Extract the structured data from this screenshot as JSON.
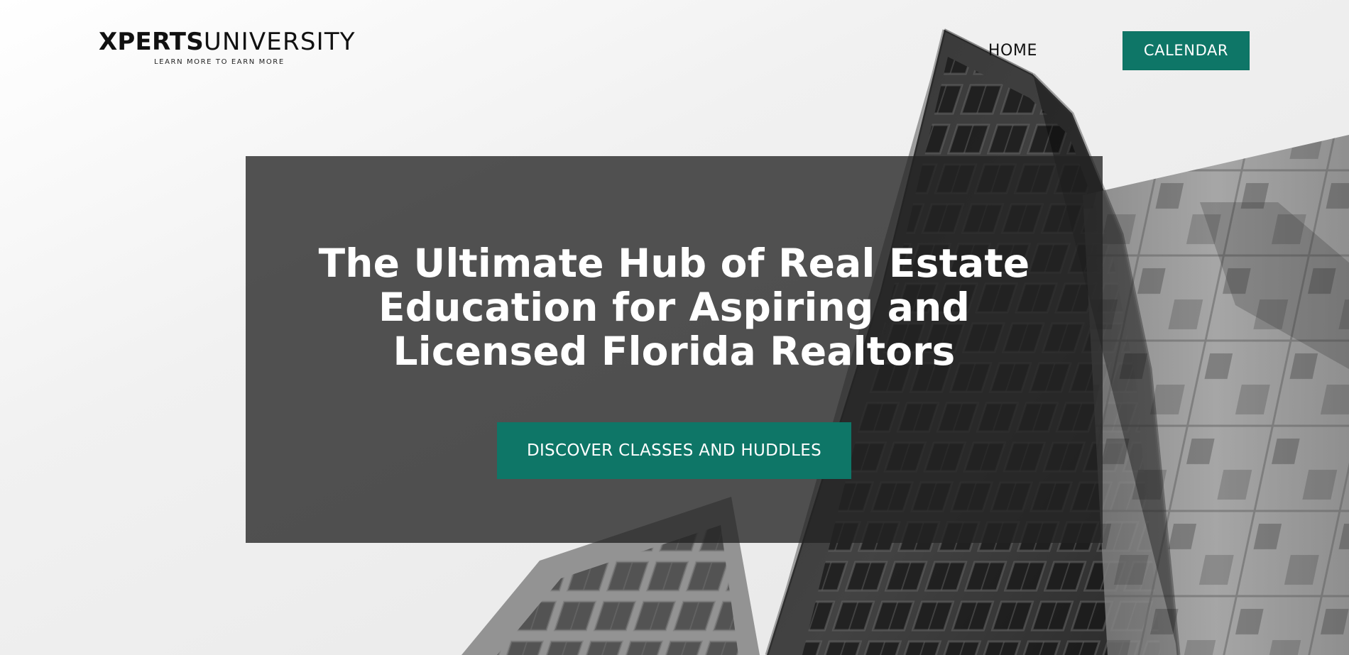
{
  "header": {
    "logo": {
      "bold": "XPERTS",
      "light": "UNIVERSITY",
      "tagline": "LEARN MORE TO EARN MORE"
    },
    "nav": {
      "home_label": "HOME",
      "calendar_label": "CALENDAR"
    }
  },
  "hero": {
    "title_lines": [
      "The Ultimate Hub of Real Estate",
      "Education for Aspiring and",
      "Licensed Florida Realtors"
    ],
    "cta_label": "DISCOVER CLASSES AND HUDDLES"
  },
  "colors": {
    "accent": "#0e7667",
    "overlay": "#232323",
    "text_on_dark": "#ffffff",
    "text_on_light": "#111111"
  },
  "icons": {
    "background_image": "building-photo"
  }
}
